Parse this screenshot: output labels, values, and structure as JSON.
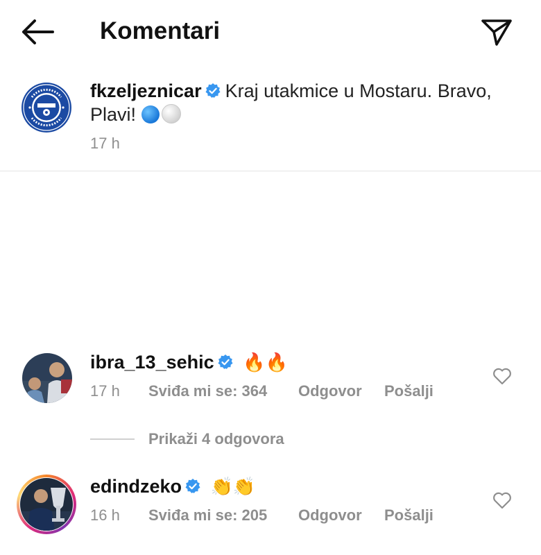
{
  "header": {
    "title": "Komentari",
    "back_icon": "arrow-left-icon",
    "share_icon": "paper-plane-icon"
  },
  "caption": {
    "username": "fkzeljeznicar",
    "verified": true,
    "text": "Kraj utakmice u Mostaru. Bravo, Plavi!",
    "emojis": [
      "blue-circle",
      "white-circle"
    ],
    "time": "17 h",
    "logo_text": "FUDBALSKI KLUB · ŽELJEZNIČAR · SARAJEVO · FOOTBALL CLUB · 1921"
  },
  "comments": [
    {
      "username": "ibra_13_sehic",
      "verified": true,
      "text": "🔥🔥",
      "time": "17 h",
      "likes": "Sviđa mi se: 364",
      "reply_label": "Odgovor",
      "send_label": "Pošalji"
    },
    {
      "username": "edindzeko",
      "verified": true,
      "text": "👏👏",
      "time": "16 h",
      "likes": "Sviđa mi se: 205",
      "reply_label": "Odgovor",
      "send_label": "Pošalji"
    }
  ],
  "view_replies": "Prikaži 4 odgovora",
  "colors": {
    "verified_blue": "#3897f0",
    "meta_gray": "#8e8e8e",
    "club_blue": "#1b4aa3"
  }
}
